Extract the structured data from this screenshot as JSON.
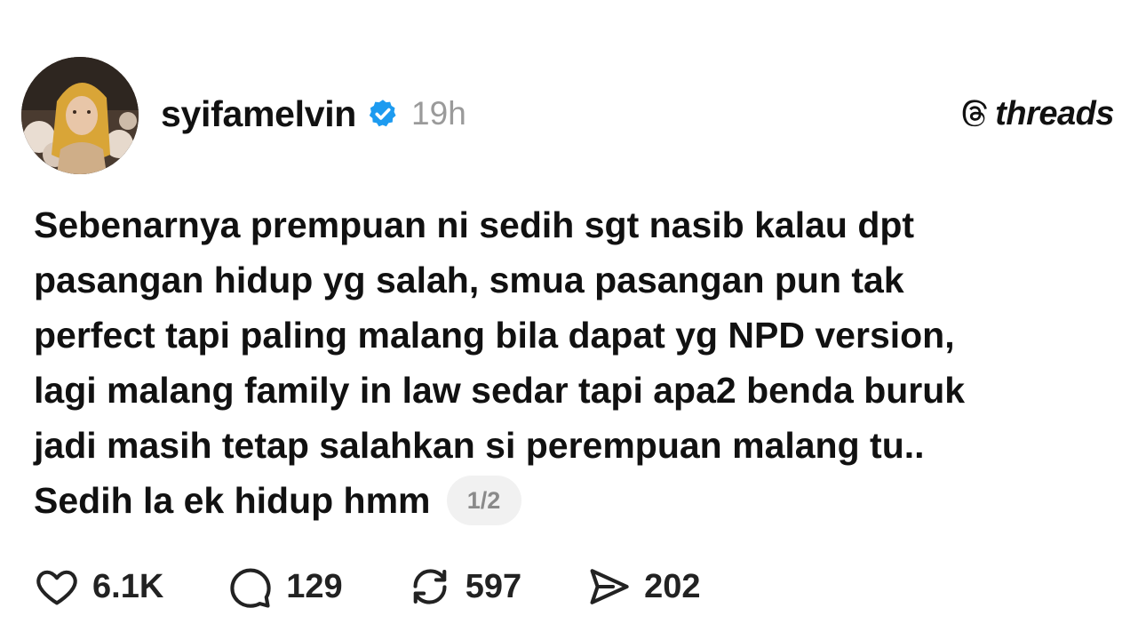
{
  "post": {
    "username": "syifamelvin",
    "time": "19h",
    "brand": "threads",
    "text_lines": [
      "Sebenarnya prempuan ni sedih sgt nasib kalau dpt",
      "pasangan hidup yg salah, smua pasangan pun tak",
      "perfect tapi paling malang bila dapat yg NPD version,",
      "lagi malang family in law sedar tapi apa2 benda buruk",
      "jadi masih tetap salahkan si perempuan malang tu..",
      "Sedih la ek hidup hmm"
    ],
    "page_indicator": "1/2"
  },
  "actions": {
    "likes": "6.1K",
    "replies": "129",
    "reposts": "597",
    "shares": "202"
  },
  "icons": {
    "verified": "verified-badge-icon",
    "brand": "threads-logo-icon",
    "like": "heart-icon",
    "reply": "speech-bubble-icon",
    "repost": "repost-icon",
    "share": "send-icon"
  },
  "colors": {
    "verified_blue": "#1d9bf0",
    "muted_text": "#9a9a9a",
    "text": "#111111"
  }
}
